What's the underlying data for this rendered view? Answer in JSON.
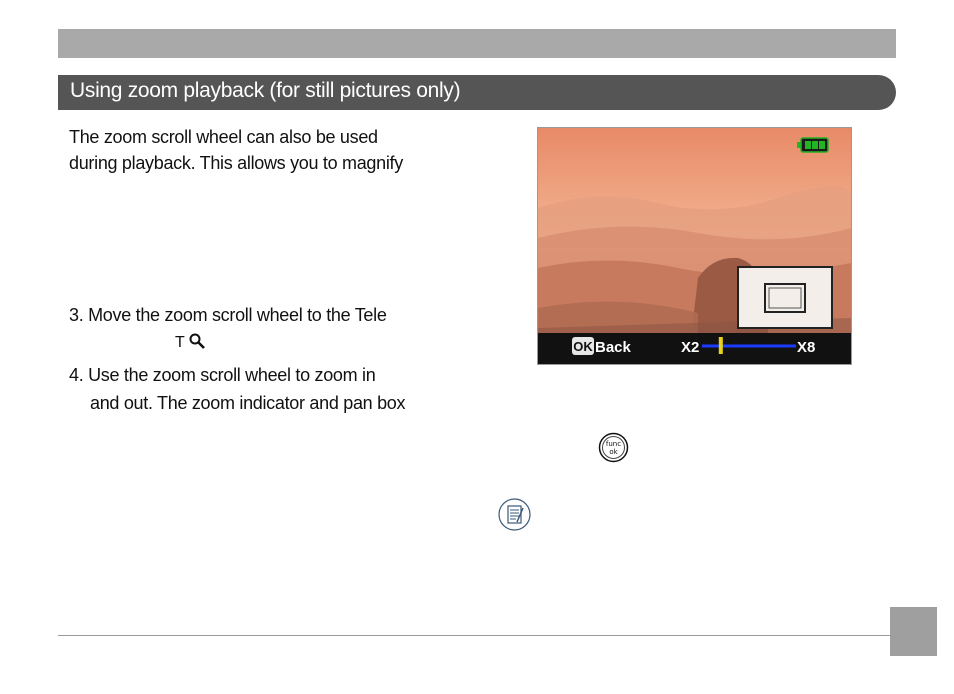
{
  "section": {
    "title": "Using zoom playback (for still pictures only)"
  },
  "intro": {
    "line1": "The zoom scroll wheel can also be used",
    "line2": "during playback. This allows you to magnify"
  },
  "steps": {
    "step3_line1": "3. Move the zoom scroll wheel to the Tele",
    "step3_symbol": "T",
    "step4_line1": "4. Use the zoom scroll wheel to zoom in",
    "step4_line2": "and out. The zoom indicator and pan box"
  },
  "screen": {
    "back_label": "Back",
    "ok_label": "OK",
    "zoom_min": "X2",
    "zoom_max": "X8",
    "zoom_level_fraction": 0.2,
    "battery_color": "#22b422"
  },
  "button_icon": {
    "line1": "func",
    "line2": "ok"
  },
  "colors": {
    "banner": "#555555",
    "top_bar": "#a9a9a9",
    "zoom_track": "#1b3cff",
    "zoom_marker": "#e8d21a"
  }
}
